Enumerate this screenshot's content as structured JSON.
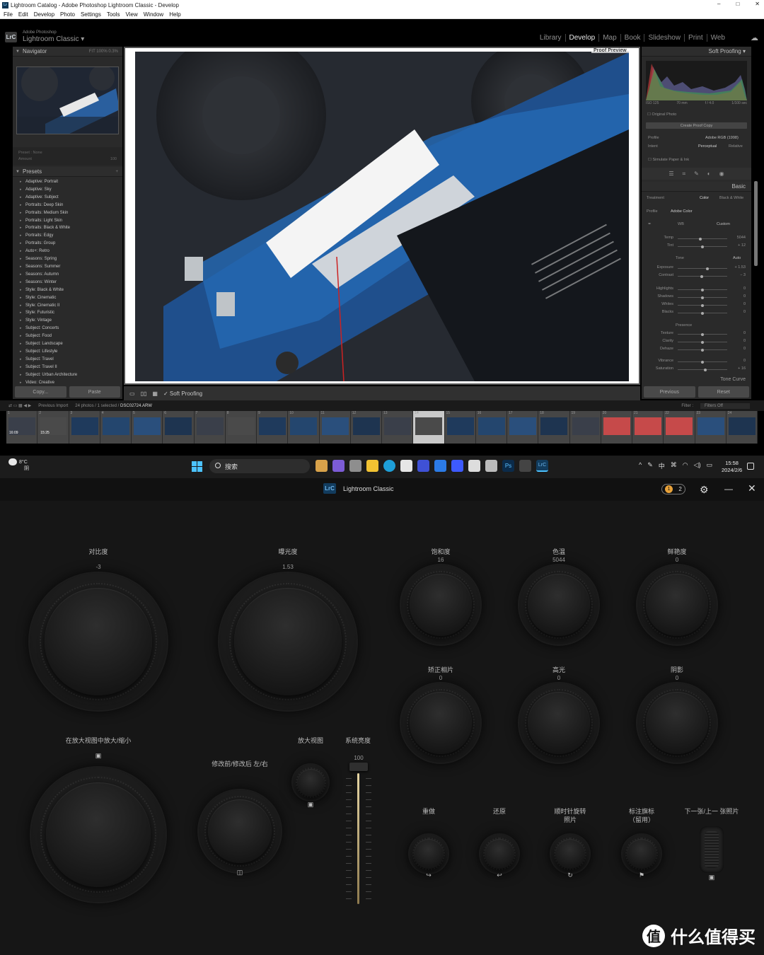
{
  "window": {
    "title": "Lightroom Catalog - Adobe Photoshop Lightroom Classic - Develop",
    "controls": [
      "–",
      "□",
      "✕"
    ]
  },
  "menu": [
    "File",
    "Edit",
    "Develop",
    "Photo",
    "Settings",
    "Tools",
    "View",
    "Window",
    "Help"
  ],
  "identity": {
    "logo": "LrC",
    "sub": "Adobe Photoshop",
    "name": "Lightroom Classic",
    "caret": "▾"
  },
  "modules": [
    {
      "label": "Library"
    },
    {
      "label": "Develop",
      "active": true
    },
    {
      "label": "Map"
    },
    {
      "label": "Book"
    },
    {
      "label": "Slideshow"
    },
    {
      "label": "Print"
    },
    {
      "label": "Web"
    }
  ],
  "navigator": {
    "title": "Navigator",
    "zoom": "FIT   100%   0.3%"
  },
  "preset_row": {
    "preset": "Preset : None",
    "amount": "Amount",
    "amount_val": "100"
  },
  "presets": {
    "title": "Presets",
    "items": [
      "Adaptive: Portrait",
      "Adaptive: Sky",
      "Adaptive: Subject",
      "Portraits: Deep Skin",
      "Portraits: Medium Skin",
      "Portraits: Light Skin",
      "Portraits: Black & White",
      "Portraits: Edgy",
      "Portraits: Group",
      "Auto+: Retro",
      "Seasons: Spring",
      "Seasons: Summer",
      "Seasons: Autumn",
      "Seasons: Winter",
      "Style: Black & White",
      "Style: Cinematic",
      "Style: Cinematic II",
      "Style: Futuristic",
      "Style: Vintage",
      "Subject: Concerts",
      "Subject: Food",
      "Subject: Landscape",
      "Subject: Lifestyle",
      "Subject: Travel",
      "Subject: Travel II",
      "Subject: Urban Architecture",
      "Video: Creative"
    ]
  },
  "left_buttons": {
    "copy": "Copy...",
    "paste": "Paste"
  },
  "photo": {
    "proof_label": "Proof Preview"
  },
  "toolbar": {
    "soft_proofing": "Soft Proofing"
  },
  "right": {
    "soft_proofing_title": "Soft Proofing",
    "iso": "ISO 125",
    "focal": "70 mm",
    "fstop": "f / 4.0",
    "shutter": "1/100 sec",
    "original_photo": "Original Photo",
    "create_proof": "Create Proof Copy",
    "profile_label": "Profile",
    "profile_val": "Adobe RGB (1998)",
    "intent_label": "Intent",
    "intent_perceptual": "Perceptual",
    "intent_relative": "Relative",
    "simulate": "Simulate Paper & Ink",
    "basic": "Basic",
    "treatment": "Treatment",
    "color": "Color",
    "bw": "Black & White",
    "profile2": "Profile",
    "adobe_color": "Adobe Color",
    "wb": "WB",
    "wb_val": "Custom",
    "tone": "Tone",
    "auto": "Auto",
    "presence": "Presence",
    "tone_curve": "Tone Curve",
    "sliders": [
      {
        "label": "Temp",
        "val": "5044"
      },
      {
        "label": "Tint",
        "val": "+ 12"
      },
      {
        "label": "Exposure",
        "val": "+ 1.53"
      },
      {
        "label": "Contrast",
        "val": "− 3"
      },
      {
        "label": "Highlights",
        "val": "0"
      },
      {
        "label": "Shadows",
        "val": "0"
      },
      {
        "label": "Whites",
        "val": "0"
      },
      {
        "label": "Blacks",
        "val": "0"
      },
      {
        "label": "Texture",
        "val": "0"
      },
      {
        "label": "Clarity",
        "val": "0"
      },
      {
        "label": "Dehaze",
        "val": "0"
      },
      {
        "label": "Vibrance",
        "val": "0"
      },
      {
        "label": "Saturation",
        "val": "+ 16"
      }
    ]
  },
  "right_buttons": {
    "previous": "Previous",
    "reset": "Reset"
  },
  "filmstrip": {
    "source": "Previous Import",
    "info": "24 photos / 1 selected /",
    "file": "DSC02724.ARW",
    "filter_label": "Filter :",
    "filter_val": "Filters Off",
    "numbers": [
      "1",
      "2",
      "3",
      "4",
      "5",
      "6",
      "7",
      "8",
      "9",
      "10",
      "11",
      "12",
      "13",
      "14",
      "15",
      "16",
      "17",
      "18",
      "19",
      "20",
      "21",
      "22",
      "23",
      "24"
    ],
    "times": [
      "16:09",
      "15:25"
    ],
    "selected_index": 13
  },
  "taskbar": {
    "temp": "8°C",
    "weather": "阴",
    "search": "搜索",
    "ime": "中",
    "time": "15:58",
    "date": "2024/2/6"
  },
  "console": {
    "app": "Lightroom Classic",
    "app_logo": "LrC",
    "page_current": "1",
    "page_total": "2",
    "knobs": {
      "contrast": {
        "label": "对比度",
        "val": "-3"
      },
      "exposure": {
        "label": "曝光度",
        "val": "1.53"
      },
      "saturation": {
        "label": "饱和度",
        "val": "16"
      },
      "temp": {
        "label": "色温",
        "val": "5044"
      },
      "vibrance": {
        "label": "鲜艳度",
        "val": "0"
      },
      "correct": {
        "label": "矫正相片",
        "val": "0"
      },
      "highlights": {
        "label": "高光",
        "val": "0"
      },
      "shadows": {
        "label": "阴影",
        "val": "0"
      },
      "zoom": {
        "label": "在放大视图中放大/缩小"
      },
      "beforeafter": {
        "label": "修改前/修改后 左/右"
      },
      "magnify": {
        "label": "放大视图"
      },
      "brightness": {
        "label": "系统亮度",
        "val": "100"
      },
      "redo": {
        "label": "重做"
      },
      "undo": {
        "label": "还原"
      },
      "rotate": {
        "label": "顺时针旋转\n照片"
      },
      "flag": {
        "label": "标注旗标\n（留用）"
      },
      "next": {
        "label": "下一张/上一\n张照片"
      }
    }
  },
  "watermark": {
    "logo": "值",
    "text": "什么值得买"
  },
  "colors": {
    "accent": "#e7d6a4",
    "lr_blue": "#71b7ec",
    "panel": "#2a2a2a",
    "console_bg": "#161616"
  }
}
